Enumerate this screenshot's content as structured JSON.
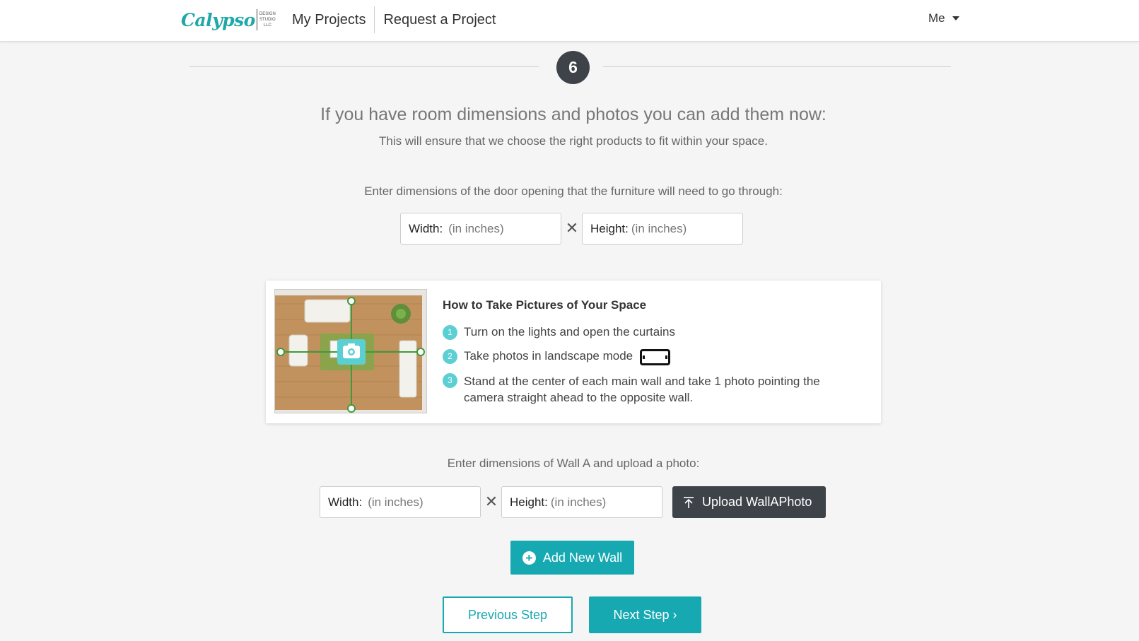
{
  "header": {
    "logo_text": "Calypso",
    "logo_sub": [
      "DESIGN",
      "STUDIO",
      "LLC"
    ],
    "nav": [
      "My Projects",
      "Request a Project"
    ],
    "user_menu": "Me"
  },
  "step": {
    "number": "6",
    "title": "If you have room dimensions and photos you can add them now:",
    "subtitle": "This will ensure that we choose the right products to fit within your space."
  },
  "door": {
    "prompt": "Enter dimensions of the door opening that the furniture will need to go through:",
    "width_label": "Width:",
    "width_placeholder": "(in inches)",
    "height_label": "Height:",
    "height_placeholder": "(in inches)",
    "times": "✕"
  },
  "guide": {
    "title": "How to Take Pictures of Your Space",
    "items": [
      {
        "num": "1",
        "text": "Turn on the lights and open the curtains"
      },
      {
        "num": "2",
        "text": "Take photos in landscape mode"
      },
      {
        "num": "3",
        "text": "Stand at the center of each main wall and take 1 photo pointing the camera straight ahead to the opposite wall."
      }
    ]
  },
  "wall": {
    "prompt": "Enter dimensions of Wall A and upload a photo:",
    "width_label": "Width:",
    "width_placeholder": "(in inches)",
    "height_label": "Height:",
    "height_placeholder": "(in inches)",
    "times": "✕",
    "upload_label": "Upload WallAPhoto"
  },
  "actions": {
    "add_wall": "Add New Wall",
    "prev": "Previous Step",
    "next": "Next Step ›"
  },
  "colors": {
    "accent": "#17a9b2",
    "dark": "#3d4349",
    "step_badge": "#5ccfd2"
  }
}
